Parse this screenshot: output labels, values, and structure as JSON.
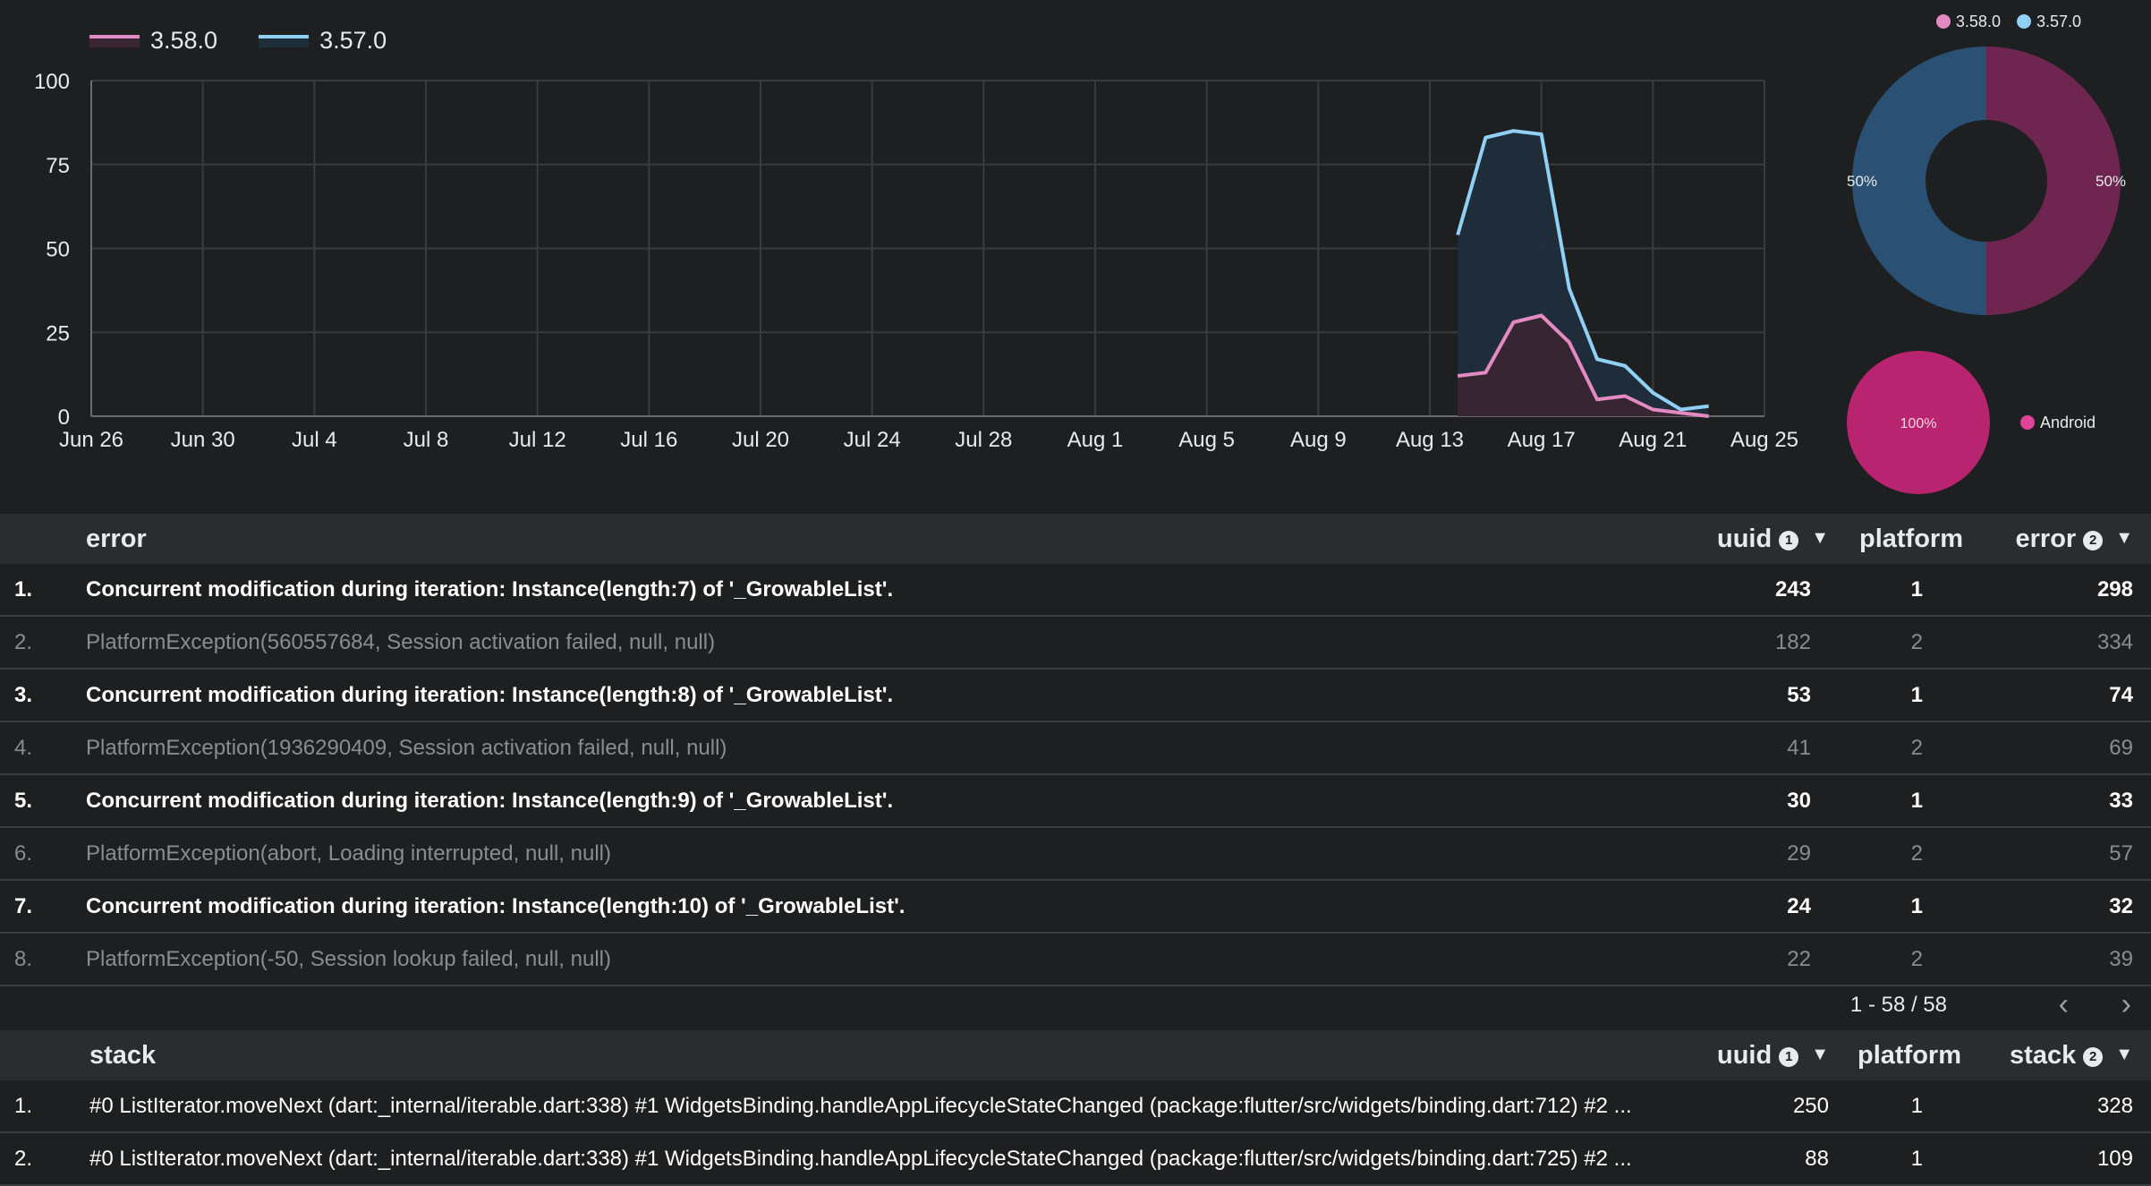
{
  "chart_data": [
    {
      "type": "area",
      "title": "",
      "xlabel": "",
      "ylabel": "",
      "ylim": [
        0,
        100
      ],
      "yticks": [
        0,
        25,
        50,
        75,
        100
      ],
      "x_start": "Jun 26",
      "x_end": "Aug 25",
      "xticks": [
        "Jun 26",
        "Jun 30",
        "Jul 4",
        "Jul 8",
        "Jul 12",
        "Jul 16",
        "Jul 20",
        "Jul 24",
        "Jul 28",
        "Aug 1",
        "Aug 5",
        "Aug 9",
        "Aug 13",
        "Aug 17",
        "Aug 21",
        "Aug 25"
      ],
      "grid": true,
      "legend_position": "top-left",
      "x": [
        "Aug 14",
        "Aug 15",
        "Aug 16",
        "Aug 17",
        "Aug 18",
        "Aug 19",
        "Aug 20",
        "Aug 21",
        "Aug 22",
        "Aug 23",
        "Aug 24"
      ],
      "series": [
        {
          "name": "3.58.0",
          "color": "#e48ac3",
          "fill": "#3a2532",
          "values": [
            12,
            13,
            28,
            30,
            22,
            5,
            6,
            2,
            1,
            0,
            null
          ]
        },
        {
          "name": "3.57.0",
          "color": "#8fd0f4",
          "fill": "#1f2e3b",
          "values": [
            54,
            83,
            85,
            84,
            38,
            17,
            15,
            7,
            2,
            3,
            null
          ]
        }
      ]
    },
    {
      "type": "pie",
      "donut": true,
      "legend_position": "top-right",
      "slices": [
        {
          "label": "3.58.0",
          "value": 50,
          "display": "50%",
          "color": "#6e2650",
          "legend_color": "#e48ac3"
        },
        {
          "label": "3.57.0",
          "value": 50,
          "display": "50%",
          "color": "#2a5174",
          "legend_color": "#8fd0f4"
        }
      ]
    },
    {
      "type": "pie",
      "donut": false,
      "legend_position": "right",
      "slices": [
        {
          "label": "Android",
          "value": 100,
          "display": "100%",
          "color": "#b8246f"
        }
      ]
    }
  ],
  "errors_table": {
    "headers": {
      "error": "error",
      "uuid": "uuid",
      "platform": "platform",
      "count": "error",
      "uuid_info": "1",
      "count_info": "2"
    },
    "rows": [
      {
        "index": "1.",
        "error": "Concurrent modification during iteration: Instance(length:7) of '_GrowableList'.",
        "uuid": "243",
        "platform": "1",
        "count": "298"
      },
      {
        "index": "2.",
        "error": "PlatformException(560557684, Session activation failed, null, null)",
        "uuid": "182",
        "platform": "2",
        "count": "334"
      },
      {
        "index": "3.",
        "error": "Concurrent modification during iteration: Instance(length:8) of '_GrowableList'.",
        "uuid": "53",
        "platform": "1",
        "count": "74"
      },
      {
        "index": "4.",
        "error": "PlatformException(1936290409, Session activation failed, null, null)",
        "uuid": "41",
        "platform": "2",
        "count": "69"
      },
      {
        "index": "5.",
        "error": "Concurrent modification during iteration: Instance(length:9) of '_GrowableList'.",
        "uuid": "30",
        "platform": "1",
        "count": "33"
      },
      {
        "index": "6.",
        "error": "PlatformException(abort, Loading interrupted, null, null)",
        "uuid": "29",
        "platform": "2",
        "count": "57"
      },
      {
        "index": "7.",
        "error": "Concurrent modification during iteration: Instance(length:10) of '_GrowableList'.",
        "uuid": "24",
        "platform": "1",
        "count": "32"
      },
      {
        "index": "8.",
        "error": "PlatformException(-50, Session lookup failed, null, null)",
        "uuid": "22",
        "platform": "2",
        "count": "39"
      }
    ],
    "pagination": {
      "range": "1 - 58 / 58",
      "prev_icon": "chevron-left",
      "next_icon": "chevron-right"
    }
  },
  "stack_table": {
    "headers": {
      "stack": "stack",
      "uuid": "uuid",
      "platform": "platform",
      "count": "stack",
      "uuid_info": "1",
      "count_info": "2"
    },
    "rows": [
      {
        "index": "1.",
        "stack": "#0 ListIterator.moveNext (dart:_internal/iterable.dart:338) #1 WidgetsBinding.handleAppLifecycleStateChanged (package:flutter/src/widgets/binding.dart:712) #2 ...",
        "uuid": "250",
        "platform": "1",
        "count": "328"
      },
      {
        "index": "2.",
        "stack": "#0 ListIterator.moveNext (dart:_internal/iterable.dart:338) #1 WidgetsBinding.handleAppLifecycleStateChanged (package:flutter/src/widgets/binding.dart:725) #2 ...",
        "uuid": "88",
        "platform": "1",
        "count": "109"
      }
    ]
  }
}
